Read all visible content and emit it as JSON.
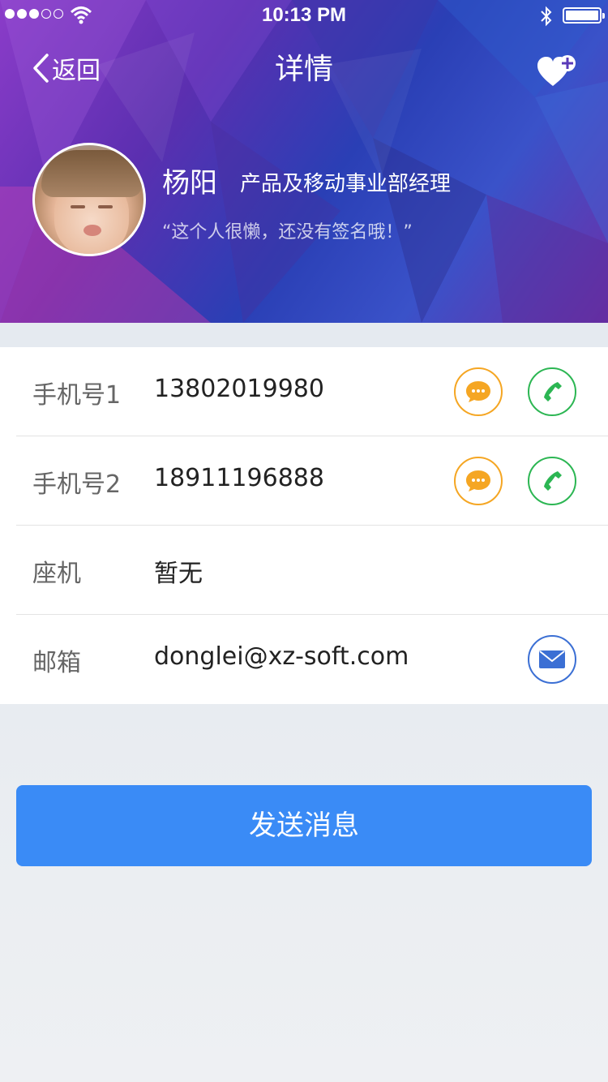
{
  "status_bar": {
    "time": "10:13 PM",
    "signal_bars_filled": 3,
    "signal_bars_total": 5,
    "icons": [
      "wifi-icon",
      "bluetooth-icon",
      "battery-icon"
    ]
  },
  "nav": {
    "back_label": "返回",
    "title": "详情",
    "action_icon": "heart-plus-icon"
  },
  "profile": {
    "name": "杨阳",
    "position": "产品及移动事业部经理",
    "signature": "“这个人很懒，还没有签名哦！”"
  },
  "contacts": [
    {
      "label": "手机号1",
      "value": "13802019980"
    },
    {
      "label": "手机号2",
      "value": "18911196888"
    },
    {
      "label": "座机",
      "value": "暂无"
    },
    {
      "label": "邮箱",
      "value": "donglei@xz-soft.com"
    }
  ],
  "send_button": {
    "label": "发送消息"
  },
  "colors": {
    "primary_button": "#3a8bf6",
    "sms_icon": "#f5a623",
    "call_icon": "#2cb653",
    "mail_icon": "#3b6fd4"
  }
}
